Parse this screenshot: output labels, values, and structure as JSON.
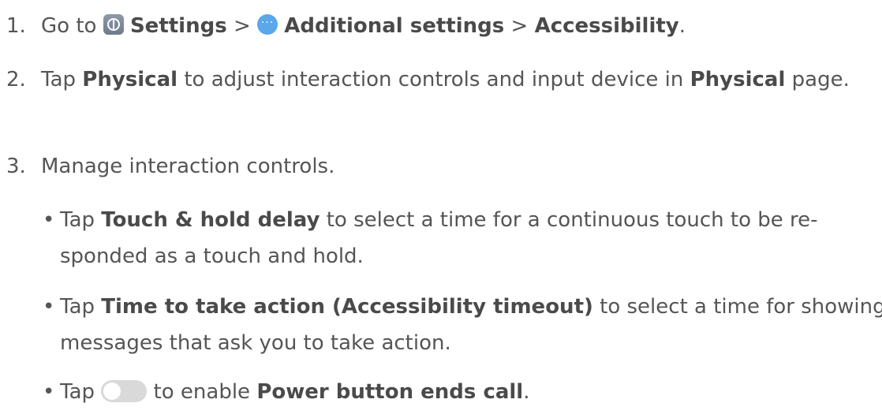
{
  "step1": {
    "num": "1.",
    "go_to": "Go to",
    "settings": "Settings",
    "sep1": ">",
    "additional": "Additional settings",
    "sep2": ">",
    "accessibility": "Accessibility",
    "end": "."
  },
  "step2": {
    "num": "2.",
    "tap": "Tap",
    "physical": "Physical",
    "mid": "to adjust interaction controls and input device in",
    "physical2": "Physical",
    "end": "page."
  },
  "step3": {
    "num": "3.",
    "text": "Manage interaction controls."
  },
  "bullets": {
    "dot": "•",
    "b1": {
      "tap": "Tap",
      "bold": "Touch & hold delay",
      "rest": "to select a time for a continuous touch to be re-sponded as a touch and hold."
    },
    "b2": {
      "tap": "Tap",
      "bold": "Time to take action (Accessibility timeout)",
      "rest": "to select a time for showing messages that ask you to take action."
    },
    "b3": {
      "tap": "Tap",
      "mid": "to enable",
      "bold": "Power button ends call",
      "end": "."
    }
  },
  "icons": {
    "settings": "settings-icon",
    "more": "more-options-icon",
    "toggle": "toggle-switch-icon",
    "more_glyph": "···"
  },
  "colors": {
    "text": "#555555",
    "settings_icon": "#7d8996",
    "more_icon": "#5aa7ea",
    "toggle_off": "#d9d9d9"
  }
}
